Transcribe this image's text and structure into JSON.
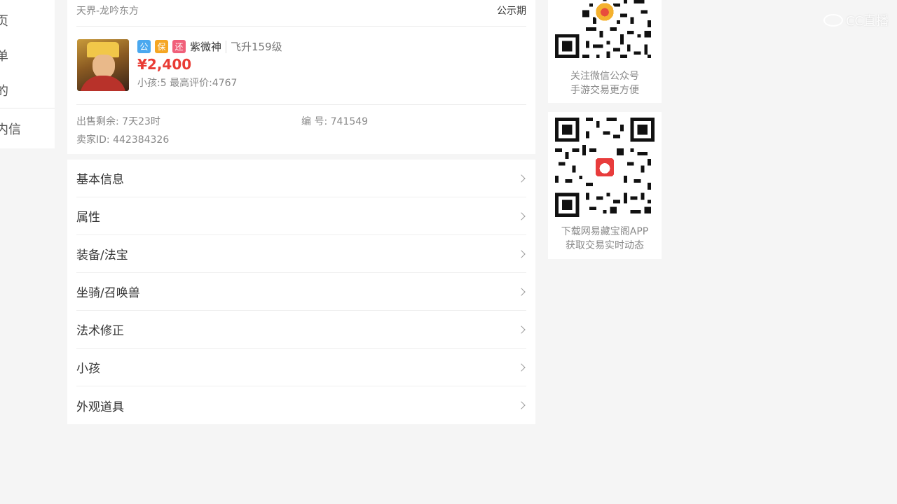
{
  "sidebar": {
    "items": [
      "页",
      "单",
      "的",
      "内信"
    ]
  },
  "card": {
    "server": "天界-龙吟东方",
    "status": "公示期",
    "tags": [
      "公",
      "保",
      "还"
    ],
    "role_name": "紫微神",
    "level": "飞升159级",
    "price": "¥2,400",
    "extra": "小孩:5 最高评价:4767",
    "remaining": "出售剩余: 7天23时",
    "serial": "编 号: 741549",
    "seller": "卖家ID: 442384326"
  },
  "sections": [
    "基本信息",
    "属性",
    "装备/法宝",
    "坐骑/召唤兽",
    "法术修正",
    "小孩",
    "外观道具"
  ],
  "qr_wechat": {
    "line1": "关注微信公众号",
    "line2": "手游交易更方便",
    "logo_icon": "bell-icon"
  },
  "qr_app": {
    "line1": "下载网易藏宝阁APP",
    "line2": "获取交易实时动态",
    "logo_icon": "bag-icon"
  },
  "watermark": "CC直播",
  "colors": {
    "price": "#e93c35",
    "tag_gong": "#4aa8ef",
    "tag_bao": "#f5a623",
    "tag_huan": "#f0607a"
  }
}
